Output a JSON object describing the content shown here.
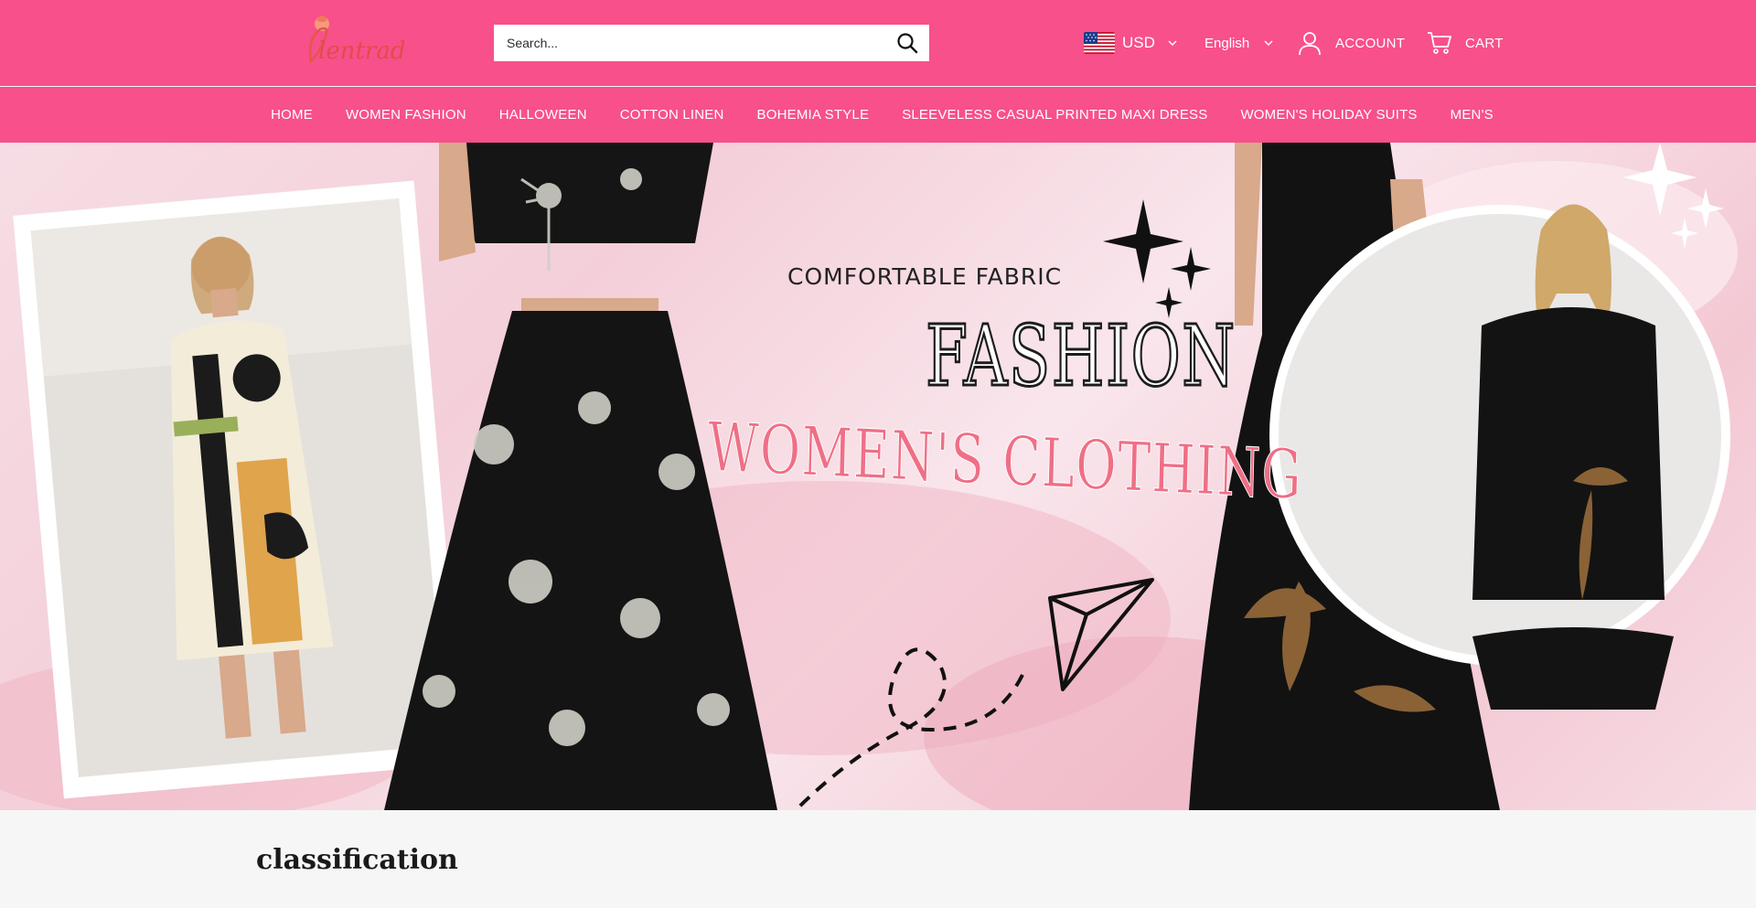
{
  "header": {
    "logo_text": "Glentradler",
    "search": {
      "placeholder": "Search..."
    },
    "currency": {
      "label": "USD",
      "flag": "us-flag"
    },
    "language": {
      "label": "English"
    },
    "account_label": "ACCOUNT",
    "cart_label": "CART",
    "background_color": "#f8508a"
  },
  "nav": {
    "items": [
      {
        "label": "HOME"
      },
      {
        "label": "WOMEN FASHION"
      },
      {
        "label": "HALLOWEEN"
      },
      {
        "label": "COTTON LINEN"
      },
      {
        "label": "BOHEMIA STYLE"
      },
      {
        "label": "SLEEVELESS CASUAL PRINTED MAXI DRESS"
      },
      {
        "label": "WOMEN'S HOLIDAY SUITS"
      },
      {
        "label": "MEN'S"
      }
    ]
  },
  "hero": {
    "tagline": "COMFORTABLE FABRIC",
    "headline": "FASHION",
    "subheadline": "WOMEN'S CLOTHING",
    "accent_color": "#ef6f86"
  },
  "sections": {
    "classification_title": "classification"
  }
}
